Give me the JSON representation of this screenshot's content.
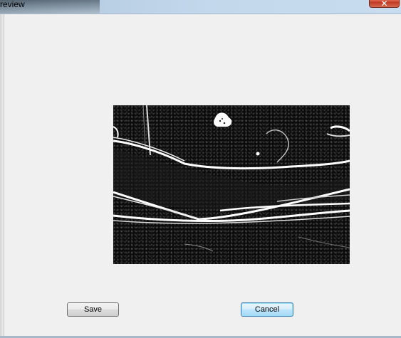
{
  "window": {
    "title": "review",
    "close_glyph": "✕"
  },
  "preview": {
    "description_icon": "edge-detected-image"
  },
  "buttons": {
    "save_label": "Save",
    "cancel_label": "Cancel"
  },
  "colors": {
    "accent_focus": "#3c7fb1",
    "close_button": "#c13b23",
    "background": "#f0f0f0"
  }
}
